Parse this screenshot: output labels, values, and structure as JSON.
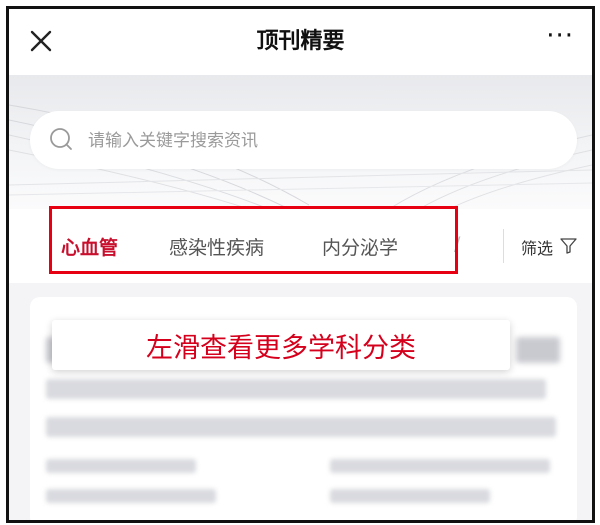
{
  "header": {
    "title": "顶刊精要",
    "close_icon": "close-icon",
    "more_label": "···"
  },
  "search": {
    "placeholder": "请输入关键字搜索资讯",
    "icon": "search-icon"
  },
  "tabs": [
    {
      "label": "心血管",
      "active": true
    },
    {
      "label": "感染性疾病",
      "active": false
    },
    {
      "label": "内分泌学",
      "active": false
    }
  ],
  "filter": {
    "label": "筛选",
    "icon": "filter-icon"
  },
  "tooltip": {
    "text": "左滑查看更多学科分类"
  },
  "colors": {
    "accent": "#c8102e",
    "highlight_border": "#e60012",
    "tooltip_text": "#d5001c"
  }
}
